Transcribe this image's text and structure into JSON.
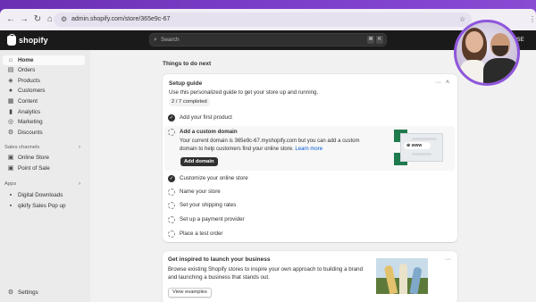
{
  "browser": {
    "url": "admin.shopify.com/store/365e9c-67"
  },
  "topbar": {
    "brand": "shopify",
    "search_placeholder": "Search",
    "shortcut_keys": [
      "⌘",
      "K"
    ],
    "store_initials": "SE"
  },
  "sidebar": {
    "items": [
      {
        "label": "Home",
        "icon": "home-icon",
        "active": true
      },
      {
        "label": "Orders",
        "icon": "orders-icon"
      },
      {
        "label": "Products",
        "icon": "tag-icon"
      },
      {
        "label": "Customers",
        "icon": "person-icon"
      },
      {
        "label": "Content",
        "icon": "content-icon"
      },
      {
        "label": "Analytics",
        "icon": "analytics-icon"
      },
      {
        "label": "Marketing",
        "icon": "marketing-icon"
      },
      {
        "label": "Discounts",
        "icon": "discount-icon"
      }
    ],
    "sales_channels_label": "Sales channels",
    "sales_channels": [
      {
        "label": "Online Store",
        "icon": "store-icon"
      },
      {
        "label": "Point of Sale",
        "icon": "pos-icon"
      }
    ],
    "apps_label": "Apps",
    "apps": [
      {
        "label": "Digital Downloads",
        "icon": "app-icon"
      },
      {
        "label": "qikify Sales Pop up",
        "icon": "app-icon"
      }
    ],
    "settings_label": "Settings"
  },
  "main": {
    "title": "Things to do next",
    "setup_guide": {
      "title": "Setup guide",
      "description": "Use this personalized guide to get your store up and running.",
      "progress_text": "2 / 7 completed",
      "tasks": [
        {
          "label": "Add your first product",
          "done": true
        },
        {
          "label": "Add a custom domain",
          "done": false,
          "expanded": true
        },
        {
          "label": "Customize your online store",
          "done": true
        },
        {
          "label": "Name your store",
          "done": false
        },
        {
          "label": "Set your shipping rates",
          "done": false
        },
        {
          "label": "Set up a payment provider",
          "done": false
        },
        {
          "label": "Place a test order",
          "done": false
        }
      ],
      "expanded_description": "Your current domain is 365e9c-67.myshopify.com but you can add a custom domain to help customers find your online store.",
      "learn_more": "Learn more",
      "add_domain_button": "Add domain",
      "illustration_text": "www"
    },
    "inspired": {
      "title": "Get inspired to launch your business",
      "description": "Browse existing Shopify stores to inspire your own approach to building a brand and launching a business that stands out.",
      "button": "View examples"
    }
  },
  "colors": {
    "chrome_gradient": "#7c3fc9",
    "topbar": "#1a1a1a",
    "sidebar_bg": "#ebebeb",
    "main_bg": "#f1f1f1",
    "link": "#005bd3"
  }
}
